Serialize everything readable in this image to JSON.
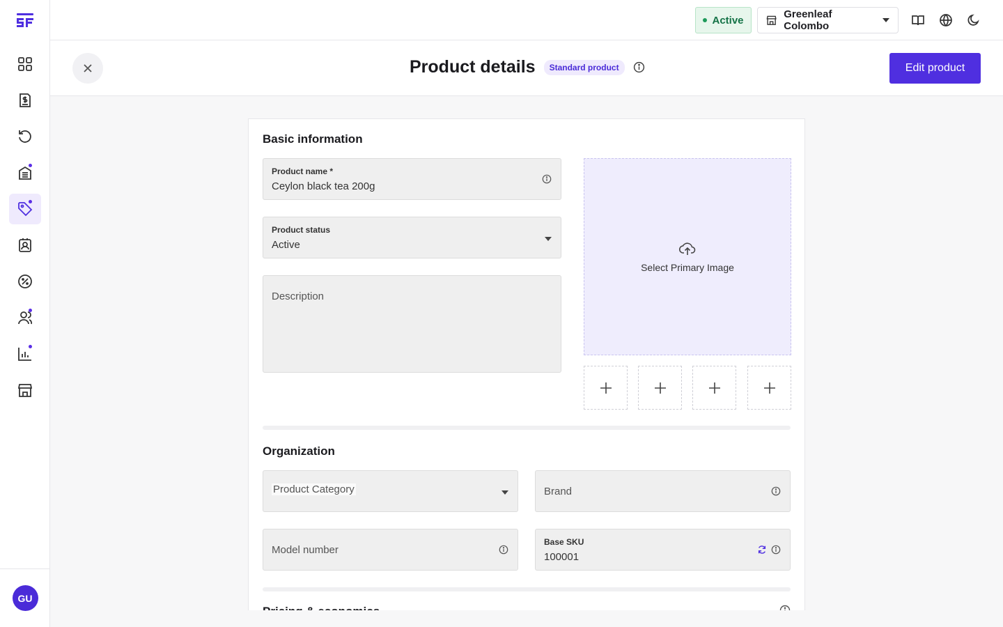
{
  "topbar": {
    "status_label": "Active",
    "store_name": "Greenleaf Colombo"
  },
  "header": {
    "title": "Product details",
    "badge": "Standard product",
    "edit_label": "Edit product"
  },
  "sidebar": {
    "items": [
      {
        "icon": "grid-icon"
      },
      {
        "icon": "invoice-dollar-icon"
      },
      {
        "icon": "refresh-icon"
      },
      {
        "icon": "inventory-icon"
      },
      {
        "icon": "tag-icon"
      },
      {
        "icon": "contact-card-icon"
      },
      {
        "icon": "discount-icon"
      },
      {
        "icon": "users-icon"
      },
      {
        "icon": "chart-icon"
      },
      {
        "icon": "store-icon"
      }
    ],
    "avatar_initials": "GU"
  },
  "basic": {
    "section_title": "Basic information",
    "product_name_label": "Product name *",
    "product_name_value": "Ceylon black tea 200g",
    "status_label": "Product status",
    "status_value": "Active",
    "description_placeholder": "Description",
    "image_label": "Select Primary Image"
  },
  "organization": {
    "section_title": "Organization",
    "category_placeholder": "Product Category",
    "brand_placeholder": "Brand",
    "model_placeholder": "Model number",
    "sku_label": "Base SKU",
    "sku_value": "100001"
  },
  "pricing": {
    "section_title": "Pricing & economics"
  },
  "colors": {
    "accent": "#4f2fe0",
    "active_green": "#157347"
  }
}
